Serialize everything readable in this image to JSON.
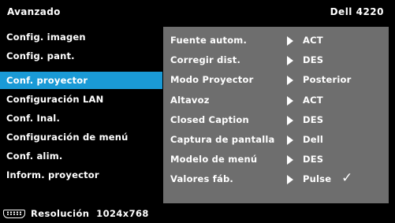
{
  "header": {
    "title": "Avanzado",
    "model": "Dell 4220"
  },
  "menu": {
    "items": [
      {
        "label": "Config. imagen"
      },
      {
        "label": "Config. pant."
      },
      {
        "label": "Conf. proyector",
        "selected": true
      },
      {
        "label": "Configuración LAN"
      },
      {
        "label": "Conf. Inal."
      },
      {
        "label": "Configuración de menú"
      },
      {
        "label": "Conf. alim."
      },
      {
        "label": "Inform. proyector"
      }
    ]
  },
  "settings": {
    "rows": [
      {
        "label": "Fuente autom.",
        "value": "ACT"
      },
      {
        "label": "Corregir dist.",
        "value": "DES"
      },
      {
        "label": "Modo Proyector",
        "value": "Posterior"
      },
      {
        "label": "Altavoz",
        "value": "ACT"
      },
      {
        "label": "Closed Caption",
        "value": "DES"
      },
      {
        "label": "Captura de pantalla",
        "value": "Dell"
      },
      {
        "label": "Modelo de menú",
        "value": "DES"
      },
      {
        "label": "Valores fáb.",
        "value": "Pulse",
        "check": "✓"
      }
    ]
  },
  "footer": {
    "icon": "vga-connector-icon",
    "resolution_text": "Resolución  1024x768"
  },
  "colors": {
    "selected": "#1a9ad6",
    "panel": "#6e6e6e",
    "background": "#000000"
  }
}
